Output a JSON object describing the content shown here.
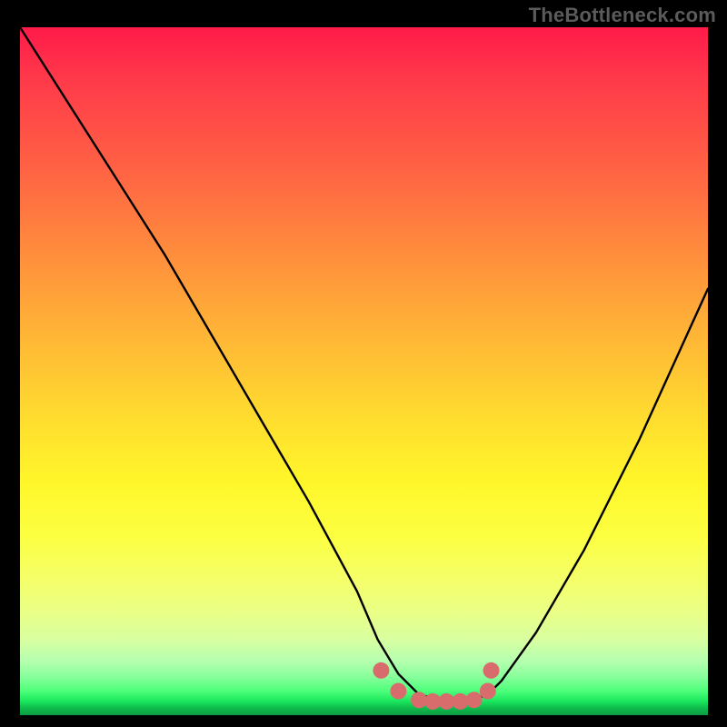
{
  "attribution": "TheBottleneck.com",
  "chart_data": {
    "type": "line",
    "title": "",
    "xlabel": "",
    "ylabel": "",
    "xlim": [
      0,
      100
    ],
    "ylim": [
      0,
      100
    ],
    "series": [
      {
        "name": "curve",
        "color": "#000000",
        "x": [
          0,
          7,
          14,
          21,
          28,
          35,
          42,
          49,
          52,
          55,
          58,
          62,
          65,
          68,
          70,
          75,
          82,
          90,
          100
        ],
        "y": [
          100,
          89,
          78,
          67,
          55,
          43,
          31,
          18,
          11,
          6,
          3,
          2,
          2,
          3,
          5,
          12,
          24,
          40,
          62
        ]
      }
    ],
    "markers": [
      {
        "name": "bottom-dots",
        "color": "#d86b6b",
        "x": [
          52.5,
          55,
          58,
          60,
          62,
          64,
          66,
          68,
          68.5
        ],
        "y": [
          6.5,
          3.5,
          2.2,
          2,
          2,
          2,
          2.2,
          3.5,
          6.5
        ]
      }
    ],
    "gradient_stops": [
      {
        "pct": 0,
        "color": "#ff1a49"
      },
      {
        "pct": 32,
        "color": "#ff8a3d"
      },
      {
        "pct": 66,
        "color": "#fff62a"
      },
      {
        "pct": 92,
        "color": "#b7ffb0"
      },
      {
        "pct": 100,
        "color": "#0a9a42"
      }
    ]
  }
}
